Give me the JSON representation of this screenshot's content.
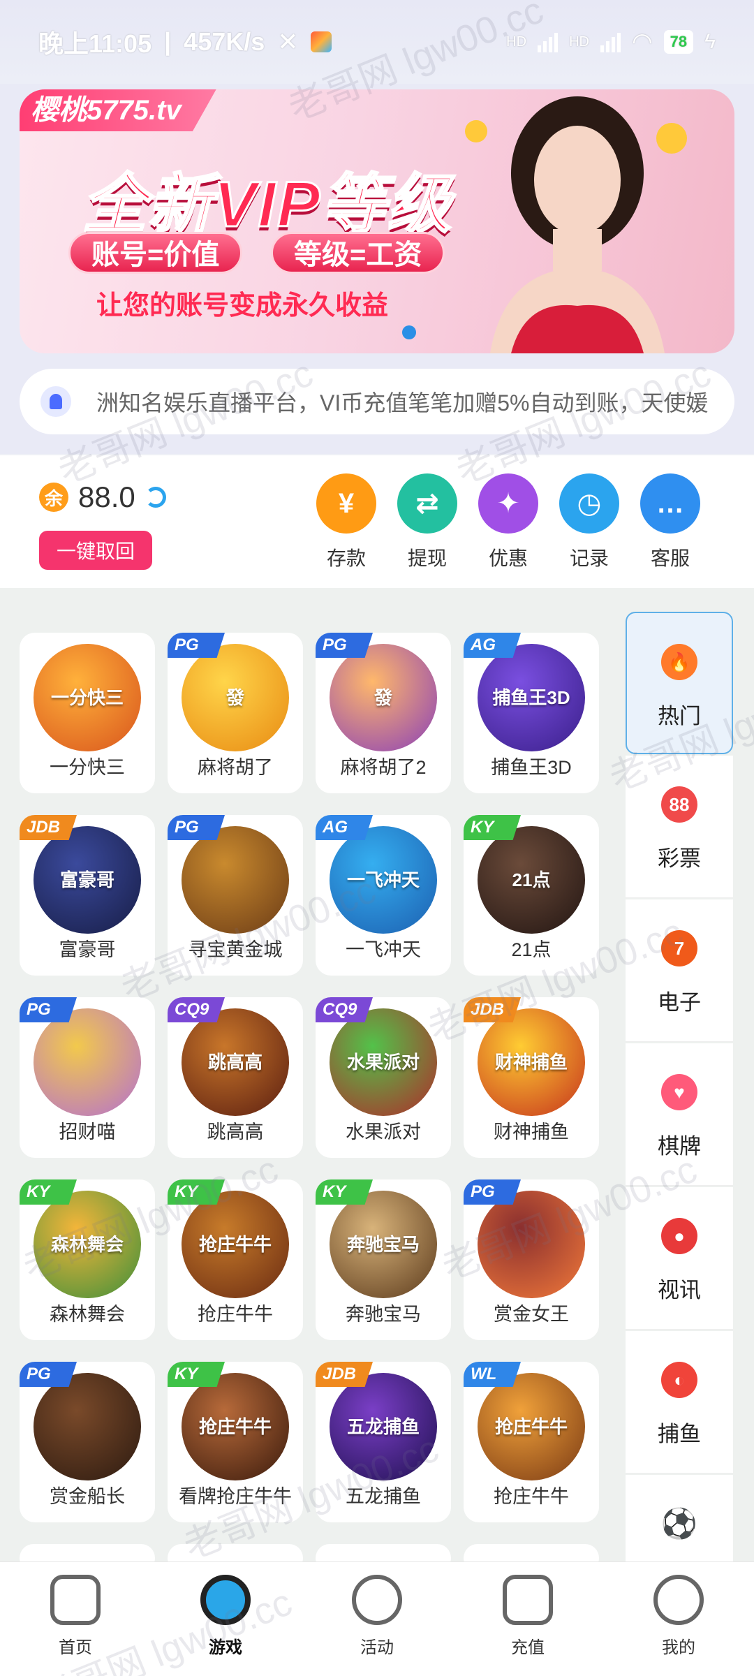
{
  "status_bar": {
    "time": "晚上11:05",
    "speed": "457K/s",
    "net1": "HD",
    "net2": "HD",
    "battery": "78"
  },
  "banner": {
    "site_tag": "樱桃5775.tv",
    "title": "全新VIP等级",
    "pill1": "账号=价值",
    "pill2": "等级=工资",
    "subtitle": "让您的账号变成永久收益"
  },
  "marquee": {
    "text": "洲知名娱乐直播平台，VI币充值笔笔加赠5%自动到账，天使媛"
  },
  "wallet": {
    "currency_badge": "余",
    "balance": "88.0",
    "recall_label": "一键取回",
    "actions": [
      {
        "label": "存款",
        "icon": "yen-icon",
        "glyph": "¥",
        "color": "#ff9b14"
      },
      {
        "label": "提现",
        "icon": "exchange-icon",
        "glyph": "⇄",
        "color": "#23c0a0"
      },
      {
        "label": "优惠",
        "icon": "tag-icon",
        "glyph": "✦",
        "color": "#a04fe6"
      },
      {
        "label": "记录",
        "icon": "clock-icon",
        "glyph": "◷",
        "color": "#2ba4ee"
      },
      {
        "label": "客服",
        "icon": "chat-icon",
        "glyph": "…",
        "color": "#2f8ff0"
      }
    ]
  },
  "games": [
    {
      "label": "一分快三",
      "tag": "",
      "tag_color": "",
      "art": "一分快三",
      "c1": "#ffb13b",
      "c2": "#d8541c"
    },
    {
      "label": "麻将胡了",
      "tag": "PG",
      "tag_color": "#2d6be0",
      "art": "發",
      "c1": "#ffd54a",
      "c2": "#e88a12"
    },
    {
      "label": "麻将胡了2",
      "tag": "PG",
      "tag_color": "#2d6be0",
      "art": "發",
      "c1": "#ffb86b",
      "c2": "#8a3fb8"
    },
    {
      "label": "捕鱼王3D",
      "tag": "AG",
      "tag_color": "#2f86e8",
      "art": "捕鱼王3D",
      "c1": "#7a4fe0",
      "c2": "#3a1f8a"
    },
    {
      "label": "富豪哥",
      "tag": "JDB",
      "tag_color": "#f08a1e",
      "art": "富豪哥",
      "c1": "#3b4a9c",
      "c2": "#171d46"
    },
    {
      "label": "寻宝黄金城",
      "tag": "PG",
      "tag_color": "#2d6be0",
      "art": "",
      "c1": "#c98a2e",
      "c2": "#6b3b16"
    },
    {
      "label": "一飞冲天",
      "tag": "AG",
      "tag_color": "#2f86e8",
      "art": "一飞冲天",
      "c1": "#35aef0",
      "c2": "#1c5fb0"
    },
    {
      "label": "21点",
      "tag": "KY",
      "tag_color": "#3ec247",
      "art": "21点",
      "c1": "#6b4b3a",
      "c2": "#221512"
    },
    {
      "label": "招财喵",
      "tag": "PG",
      "tag_color": "#2d6be0",
      "art": "",
      "c1": "#f2c94c",
      "c2": "#b46fd0"
    },
    {
      "label": "跳高高",
      "tag": "CQ9",
      "tag_color": "#7b49d6",
      "art": "跳高高",
      "c1": "#c8762a",
      "c2": "#5a1d10"
    },
    {
      "label": "水果派对",
      "tag": "CQ9",
      "tag_color": "#7b49d6",
      "art": "水果派对",
      "c1": "#53c24a",
      "c2": "#b02a2a"
    },
    {
      "label": "财神捕鱼",
      "tag": "JDB",
      "tag_color": "#f08a1e",
      "art": "财神捕鱼",
      "c1": "#ffcc33",
      "c2": "#c5321c"
    },
    {
      "label": "森林舞会",
      "tag": "KY",
      "tag_color": "#3ec247",
      "art": "森林舞会",
      "c1": "#f3b53a",
      "c2": "#3c8f3a"
    },
    {
      "label": "抢庄牛牛",
      "tag": "KY",
      "tag_color": "#3ec247",
      "art": "抢庄牛牛",
      "c1": "#c77b2a",
      "c2": "#6a2b12"
    },
    {
      "label": "奔驰宝马",
      "tag": "KY",
      "tag_color": "#3ec247",
      "art": "奔驰宝马",
      "c1": "#d8b37a",
      "c2": "#5b3a1c"
    },
    {
      "label": "赏金女王",
      "tag": "PG",
      "tag_color": "#2d6be0",
      "art": "",
      "c1": "#8a2f2f",
      "c2": "#f27a3a"
    },
    {
      "label": "赏金船长",
      "tag": "PG",
      "tag_color": "#2d6be0",
      "art": "",
      "c1": "#7a4a2a",
      "c2": "#2c1a10"
    },
    {
      "label": "看牌抢庄牛牛",
      "tag": "KY",
      "tag_color": "#3ec247",
      "art": "抢庄牛牛",
      "c1": "#b76a3a",
      "c2": "#3a1a0c"
    },
    {
      "label": "五龙捕鱼",
      "tag": "JDB",
      "tag_color": "#f08a1e",
      "art": "五龙捕鱼",
      "c1": "#7a3fc6",
      "c2": "#1f1050"
    },
    {
      "label": "抢庄牛牛",
      "tag": "WL",
      "tag_color": "#2f86e8",
      "art": "抢庄牛牛",
      "c1": "#f0a13a",
      "c2": "#7a3a14"
    }
  ],
  "categories": [
    {
      "label": "热门",
      "icon": "fire-icon",
      "glyph": "🔥",
      "color": "#ff7a2a",
      "active": true
    },
    {
      "label": "彩票",
      "icon": "lottery-ball-icon",
      "glyph": "88",
      "color": "#f04a4a",
      "active": false
    },
    {
      "label": "电子",
      "icon": "slot-7-icon",
      "glyph": "7",
      "color": "#f05a1a",
      "active": false
    },
    {
      "label": "棋牌",
      "icon": "cards-icon",
      "glyph": "♥",
      "color": "#ff5a7a",
      "active": false
    },
    {
      "label": "视讯",
      "icon": "chip-icon",
      "glyph": "●",
      "color": "#e83a3a",
      "active": false
    },
    {
      "label": "捕鱼",
      "icon": "fish-icon",
      "glyph": "◐",
      "color": "#f0443a",
      "active": false
    },
    {
      "label": "",
      "icon": "soccer-ball-icon",
      "glyph": "⚽",
      "color": "#ffffff",
      "active": false
    }
  ],
  "bottom_nav": [
    {
      "label": "首页",
      "icon": "home-icon",
      "active": false
    },
    {
      "label": "游戏",
      "icon": "gamepad-icon",
      "active": true
    },
    {
      "label": "活动",
      "icon": "flag-icon",
      "active": false
    },
    {
      "label": "充值",
      "icon": "wallet-icon",
      "active": false
    },
    {
      "label": "我的",
      "icon": "profile-face-icon",
      "active": false
    }
  ],
  "watermark": "老哥网 lgw00.cc"
}
